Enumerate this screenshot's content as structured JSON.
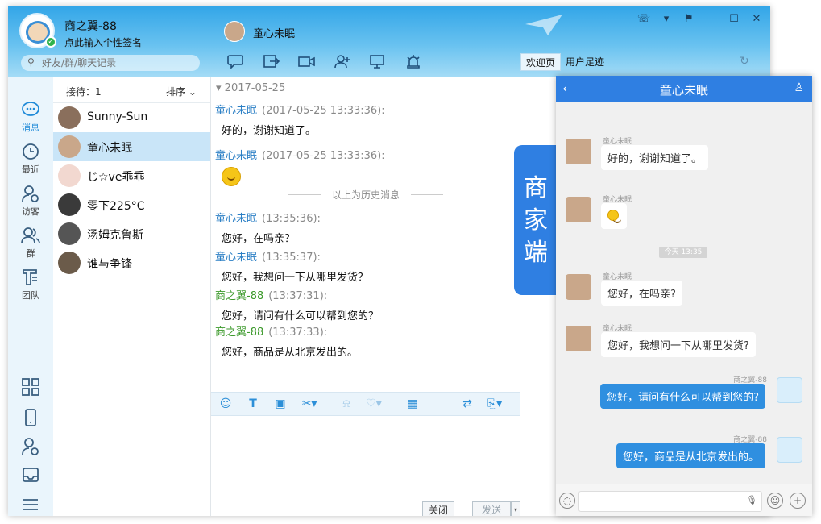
{
  "header": {
    "user_name": "商之翼-88",
    "user_sign": "点此输入个性签名",
    "search_placeholder": "好友/群/聊天记录",
    "contact_name": "童心未眠",
    "tabs": [
      "欢迎页",
      "用户足迹"
    ]
  },
  "leftnav": {
    "items": [
      {
        "label": "消息",
        "icon": "message-icon"
      },
      {
        "label": "最近",
        "icon": "clock-icon"
      },
      {
        "label": "访客",
        "icon": "visitor-icon"
      },
      {
        "label": "群",
        "icon": "group-icon"
      },
      {
        "label": "团队",
        "icon": "team-icon"
      }
    ]
  },
  "contacts": {
    "receiving_label": "接待：1",
    "sort_label": "排序",
    "items": [
      {
        "name": "Sunny-Sun",
        "active": false
      },
      {
        "name": "童心未眠",
        "active": true
      },
      {
        "name": "じ☆ve乖乖",
        "active": false
      },
      {
        "name": "零下225°C",
        "active": false
      },
      {
        "name": "汤姆克鲁斯",
        "active": false
      },
      {
        "name": "谁与争锋",
        "active": false
      }
    ]
  },
  "chat": {
    "date": "2017-05-25",
    "messages": [
      {
        "who": "童心未眠",
        "time": "(2017-05-25 13:33:36):",
        "body": "好的，谢谢知道了。",
        "self": false
      },
      {
        "who": "童心未眠",
        "time": "(2017-05-25 13:33:36):",
        "body": "",
        "emoji": true,
        "self": false
      },
      {
        "who": "童心未眠",
        "time": "(13:35:36):",
        "body": "您好，在吗亲？",
        "self": false
      },
      {
        "who": "童心未眠",
        "time": "(13:35:37):",
        "body": "您好，我想问一下从哪里发货？",
        "self": false
      },
      {
        "who": "商之翼-88",
        "time": "(13:37:31):",
        "body": "您好，请问有什么可以帮到您的？",
        "self": true
      },
      {
        "who": "商之翼-88",
        "time": "(13:37:33):",
        "body": "您好，商品是从北京发出的。",
        "self": true
      }
    ],
    "history_label": "以上为历史消息",
    "close_label": "关闭",
    "send_label": "发送"
  },
  "merchant_tab": "商家端",
  "mobile": {
    "title": "童心未眠",
    "separator": "今天 13:35",
    "messages": [
      {
        "name": "童心未眠",
        "body": "好的，谢谢知道了。",
        "self": false
      },
      {
        "name": "童心未眠",
        "body": "",
        "emoji": true,
        "self": false
      },
      {
        "name": "童心未眠",
        "body": "您好，在吗亲?",
        "self": false
      },
      {
        "name": "童心未眠",
        "body": "您好，我想问一下从哪里发货?",
        "self": false
      },
      {
        "name": "商之翼-88",
        "body": "您好，请问有什么可以帮到您的?",
        "self": true
      },
      {
        "name": "商之翼-88",
        "body": "您好，商品是从北京发出的。",
        "self": true
      }
    ]
  },
  "colors": {
    "accent": "#2f7fe2",
    "header_top": "#33a6e8",
    "self_name": "#3d9a2c",
    "other_name": "#2b7fc5"
  }
}
